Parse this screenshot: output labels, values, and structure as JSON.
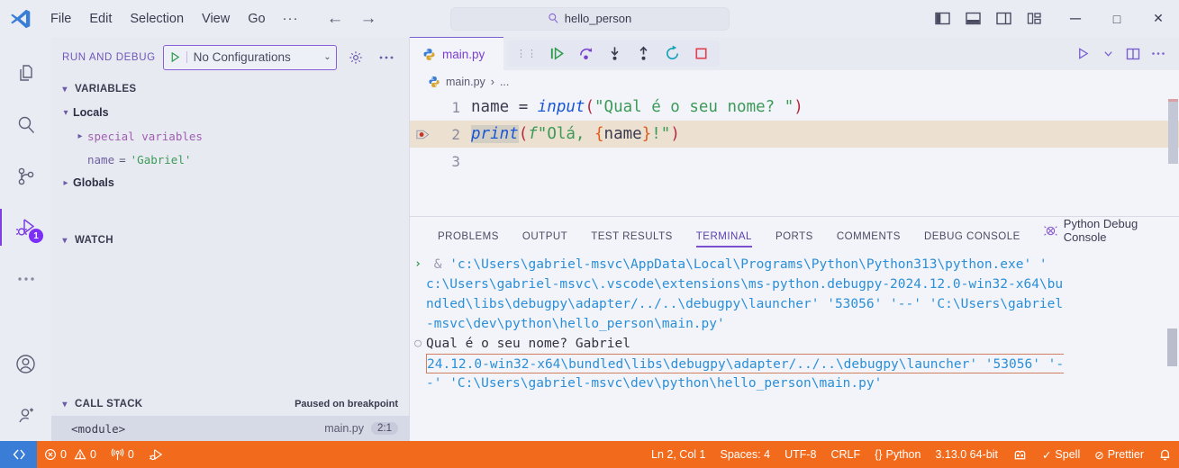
{
  "titlebar": {
    "menu": [
      "File",
      "Edit",
      "Selection",
      "View",
      "Go",
      "···"
    ],
    "back_icon": "←",
    "forward_icon": "→",
    "search_value": "hello_person",
    "search_icon": "search-icon",
    "layout_icons": [
      "toggle-primary-sidebar",
      "toggle-panel",
      "toggle-secondary-sidebar",
      "customize-layout"
    ],
    "minimize": "─",
    "maximize": "□",
    "close": "✕"
  },
  "activitybar": {
    "items": [
      {
        "name": "explorer",
        "icon": "files-icon"
      },
      {
        "name": "search",
        "icon": "search-icon"
      },
      {
        "name": "source-control",
        "icon": "source-control-icon"
      },
      {
        "name": "run-and-debug",
        "icon": "debug-icon",
        "badge": "1",
        "active": true
      },
      {
        "name": "more-views",
        "icon": "ellipsis-icon"
      }
    ],
    "bottom": [
      {
        "name": "accounts",
        "icon": "account-icon"
      },
      {
        "name": "manage",
        "icon": "settings-remote-icon"
      }
    ]
  },
  "sidebar": {
    "title": "RUN AND DEBUG",
    "config_label": "No Configurations",
    "config_caret": "⌄",
    "play_icon": "play-icon",
    "gear_icon": "gear-icon",
    "more_icon": "ellipsis-icon",
    "variables": {
      "header": "VARIABLES",
      "locals_label": "Locals",
      "special_variables": "special variables",
      "var_name": "name",
      "var_eq": "=",
      "var_value": "'Gabriel'",
      "globals_label": "Globals"
    },
    "watch": {
      "header": "WATCH"
    },
    "callstack": {
      "header": "CALL STACK",
      "status": "Paused on breakpoint",
      "frame": "<module>",
      "frame_file": "main.py",
      "frame_pos": "2:1"
    }
  },
  "editor": {
    "tab_label": "main.py",
    "tab_icon": "python-file-icon",
    "debug_toolbar": [
      {
        "name": "drag-handle",
        "icon": "grip-icon"
      },
      {
        "name": "continue",
        "icon": "continue-icon"
      },
      {
        "name": "step-over",
        "icon": "step-over-icon"
      },
      {
        "name": "step-into",
        "icon": "step-into-icon"
      },
      {
        "name": "step-out",
        "icon": "step-out-icon"
      },
      {
        "name": "restart",
        "icon": "restart-icon"
      },
      {
        "name": "stop",
        "icon": "stop-icon"
      }
    ],
    "actions": [
      {
        "name": "run-python-file",
        "icon": "play-icon"
      },
      {
        "name": "run-dropdown",
        "icon": "chevron-down-icon"
      },
      {
        "name": "split-editor",
        "icon": "split-editor-icon"
      },
      {
        "name": "more-actions",
        "icon": "ellipsis-icon"
      }
    ],
    "breadcrumb": [
      "main.py",
      "›",
      "..."
    ],
    "lines": [
      {
        "num": "1",
        "breakpoint": false,
        "current": false
      },
      {
        "num": "2",
        "breakpoint": true,
        "current": true
      },
      {
        "num": "3",
        "breakpoint": false,
        "current": false
      }
    ],
    "line1": {
      "var": "name",
      "eq": " = ",
      "fn": "input",
      "open": "(",
      "str": "\"Qual é o seu nome? \"",
      "close": ")"
    },
    "line2": {
      "fn": "print",
      "open": "(",
      "fprefix": "f",
      "str_a": "\"Olá, ",
      "brace_open": "{",
      "ident": "name",
      "brace_close": "}",
      "str_b": "!\"",
      "close": ")"
    }
  },
  "panel": {
    "tabs": [
      "PROBLEMS",
      "OUTPUT",
      "TEST RESULTS",
      "TERMINAL",
      "PORTS",
      "COMMENTS",
      "DEBUG CONSOLE"
    ],
    "active_tab": "TERMINAL",
    "terminal_name": "Python Debug Console",
    "terminal_icon": "debug-console-icon",
    "terminal_lines": [
      {
        "mark": "›",
        "mark_class": "t-green",
        "segments": [
          {
            "text": " & ",
            "cls": "t-gray"
          },
          {
            "text": "'c:\\Users\\gabriel-msvc\\AppData\\Local\\Programs\\Python\\Python313\\python.exe' '",
            "cls": "t-blue"
          }
        ]
      },
      {
        "mark": "",
        "segments": [
          {
            "text": "c:\\Users\\gabriel-msvc\\.vscode\\extensions\\ms-python.debugpy-2024.12.0-win32-x64\\bu",
            "cls": "t-blue"
          }
        ]
      },
      {
        "mark": "",
        "segments": [
          {
            "text": "ndled\\libs\\debugpy\\adapter/../..\\debugpy\\launcher' '53056' '--' 'C:\\Users\\gabriel",
            "cls": "t-blue"
          }
        ]
      },
      {
        "mark": "",
        "segments": [
          {
            "text": "-msvc\\dev\\python\\hello_person\\main.py'",
            "cls": "t-blue"
          }
        ]
      },
      {
        "mark": "○",
        "mark_class": "t-gray",
        "segments": [
          {
            "text": "Qual é o seu nome? Gabriel",
            "cls": "t-dark"
          }
        ]
      },
      {
        "mark": "",
        "cursor_first": true,
        "segments": [
          {
            "text": "24.12.0-win32-x64\\bundled\\libs\\debugpy\\adapter/../..\\debugpy\\launcher' '53056' '-",
            "cls": "t-blue"
          }
        ]
      },
      {
        "mark": "",
        "segments": [
          {
            "text": "-' 'C:\\Users\\gabriel-msvc\\dev\\python\\hello_person\\main.py'",
            "cls": "t-blue"
          }
        ]
      }
    ]
  },
  "statusbar": {
    "remote_icon": "remote-window-icon",
    "errors_icon": "error-icon",
    "errors": "0",
    "warnings_icon": "warning-icon",
    "warnings": "0",
    "ports_icon": "radio-tower-icon",
    "ports": "0",
    "debug_icon": "debug-alt-icon",
    "position": "Ln 2, Col 1",
    "indentation": "Spaces: 4",
    "encoding": "UTF-8",
    "eol": "CRLF",
    "language_icon": "{}",
    "language": "Python",
    "interpreter": "3.13.0 64-bit",
    "pets_icon": "pets-icon",
    "spell_icon": "✓",
    "spell": "Spell",
    "prettier_icon": "⊘",
    "prettier": "Prettier",
    "bell_icon": "bell-dot-icon"
  },
  "colors": {
    "accent_orange": "#f26b1d",
    "accent_purple": "#7a4fd0",
    "terminal_blue": "#2a8fd8",
    "string_green": "#3c9a58",
    "function_blue": "#1a56d6"
  }
}
